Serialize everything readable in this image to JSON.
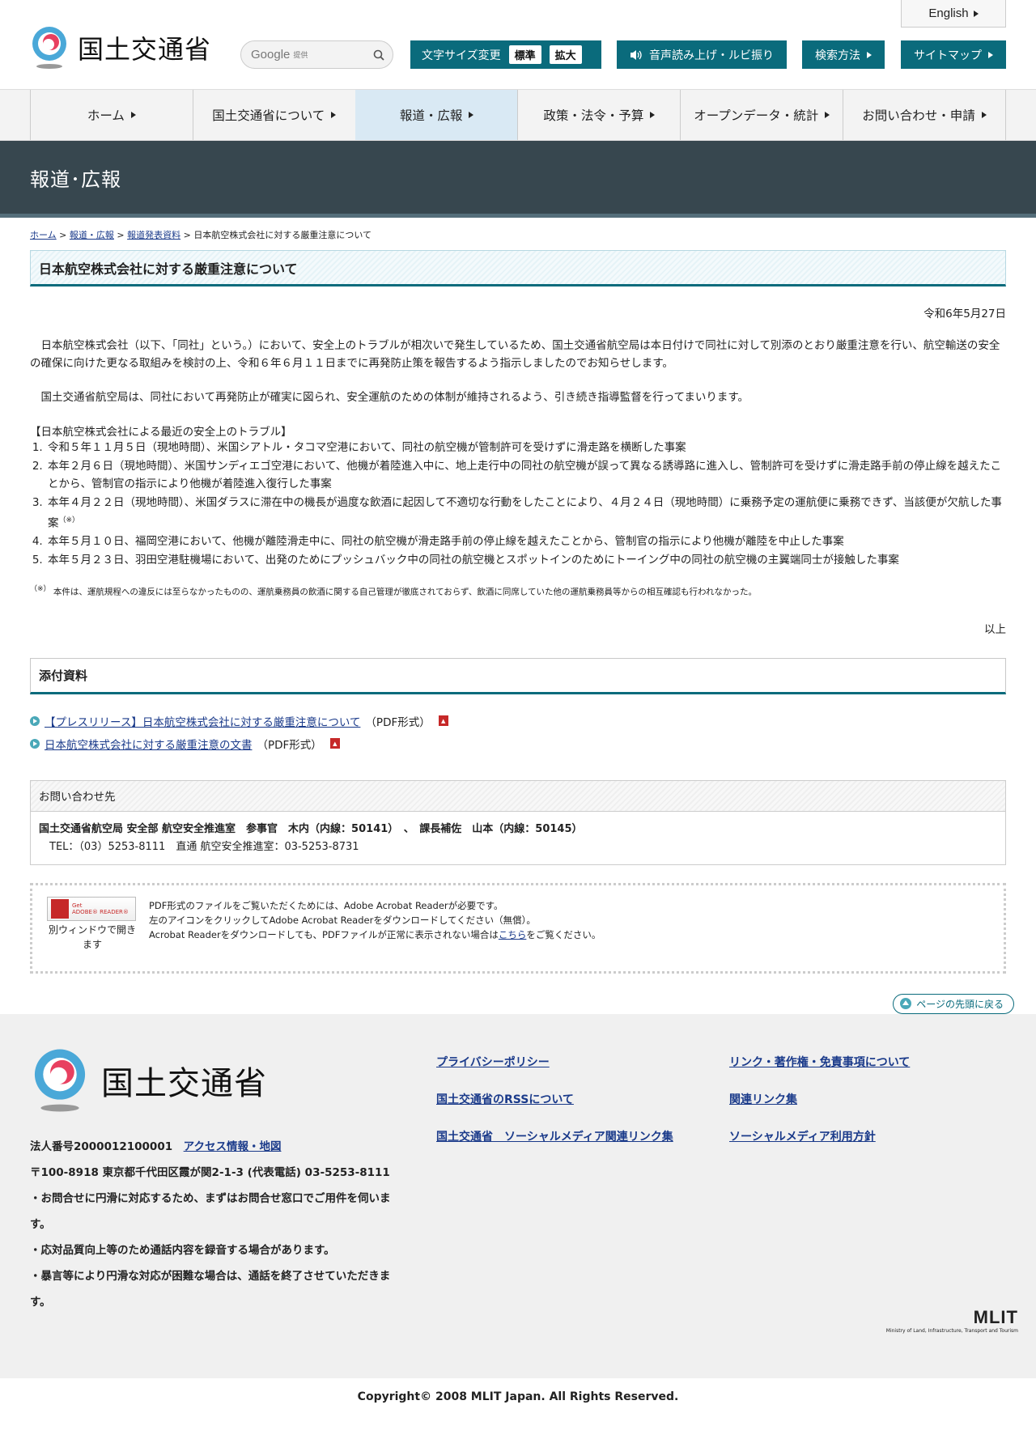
{
  "header": {
    "english": "English",
    "logo_text": "国土交通省",
    "search": {
      "label": "Google",
      "sub": "提供"
    },
    "font_size": {
      "label": "文字サイズ変更",
      "standard": "標準",
      "large": "拡大"
    },
    "voice": "音声読み上げ・ルビ振り",
    "search_method": "検索方法",
    "sitemap": "サイトマップ"
  },
  "nav": [
    "ホーム",
    "国土交通省について",
    "報道・広報",
    "政策・法令・予算",
    "オープンデータ・統計",
    "お問い合わせ・申請"
  ],
  "banner": "報道･広報",
  "breadcrumb": [
    "ホーム",
    "報道・広報",
    "報道発表資料",
    "日本航空株式会社に対する厳重注意について"
  ],
  "title": "日本航空株式会社に対する厳重注意について",
  "date": "令和6年5月27日",
  "para1": "日本航空株式会社（以下、「同社」という。）において、安全上のトラブルが相次いで発生しているため、国土交通省航空局は本日付けで同社に対して別添のとおり厳重注意を行い、航空輸送の安全の確保に向けた更なる取組みを検討の上、令和６年６月１１日までに再発防止策を報告するよう指示しましたのでお知らせします。",
  "para2": "国土交通省航空局は、同社において再発防止が確実に図られ、安全運航のための体制が維持されるよう、引き続き指導監督を行ってまいります。",
  "list_heading": "【日本航空株式会社による最近の安全上のトラブル】",
  "incidents": [
    "令和５年１１月５日（現地時間）、米国シアトル・タコマ空港において、同社の航空機が管制許可を受けずに滑走路を横断した事案",
    "本年２月６日（現地時間）、米国サンディエゴ空港において、他機が着陸進入中に、地上走行中の同社の航空機が誤って異なる誘導路に進入し、管制許可を受けずに滑走路手前の停止線を越えたことから、管制官の指示により他機が着陸進入復行した事案",
    "本年４月２２日（現地時間）、米国ダラスに滞在中の機長が過度な飲酒に起因して不適切な行動をしたことにより、４月２４日（現地時間）に乗務予定の運航便に乗務できず、当該便が欠航した事案",
    "本年５月１０日、福岡空港において、他機が離陸滑走中に、同社の航空機が滑走路手前の停止線を越えたことから、管制官の指示により他機が離陸を中止した事案",
    "本年５月２３日、羽田空港駐機場において、出発のためにプッシュバック中の同社の航空機とスポットインのためにトーイング中の同社の航空機の主翼端同士が接触した事案"
  ],
  "incident3_sup": "（※）",
  "note_mark": "（※）",
  "note": "本件は、運航規程への違反には至らなかったものの、運航乗務員の飲酒に関する自己管理が徹底されておらず、飲酒に同席していた他の運航乗務員等からの相互確認も行われなかった。",
  "ijo": "以上",
  "attachments": {
    "heading": "添付資料",
    "items": [
      {
        "label": "【プレスリリース】日本航空株式会社に対する厳重注意について",
        "format": "（PDF形式）"
      },
      {
        "label": "日本航空株式会社に対する厳重注意の文書",
        "format": "（PDF形式）"
      }
    ]
  },
  "contact": {
    "heading": "お問い合わせ先",
    "line1": "国土交通省航空局 安全部 航空安全推進室　参事官　木内（内線：50141）　、　課長補佐　山本（内線：50145）",
    "line2": "TEL：（03）5253-8111　直通 航空安全推進室：03-5253-8731"
  },
  "adobe": {
    "badge_get": "Get",
    "badge_name": "ADOBE® READER®",
    "caption": "別ウィンドウで開きます",
    "text1": "PDF形式のファイルをご覧いただくためには、Adobe Acrobat Readerが必要です。",
    "text2": "左のアイコンをクリックしてAdobe Acrobat Readerをダウンロードしてください（無償）。",
    "text3a": "Acrobat Readerをダウンロードしても、PDFファイルが正常に表示されない場合は",
    "text3link": "こちら",
    "text3b": "をご覧ください。"
  },
  "page_top": "ページの先頭に戻る",
  "footer": {
    "logo_text": "国土交通省",
    "corp_no": "法人番号2000012100001",
    "access": "アクセス情報・地図",
    "address": "〒100-8918 東京都千代田区霞が関2-1-3 (代表電話) 03-5253-8111",
    "notice1": "・お問合せに円滑に対応するため、まずはお問合せ窓口でご用件を伺います。",
    "notice2": "・応対品質向上等のため通話内容を録音する場合があります。",
    "notice3": "・暴言等により円滑な対応が困難な場合は、通話を終了させていただきます。",
    "links": [
      "プライバシーポリシー",
      "リンク・著作権・免責事項について",
      "国土交通省のRSSについて",
      "関連リンク集",
      "国土交通省　ソーシャルメディア関連リンク集",
      "ソーシャルメディア利用方針"
    ],
    "mlit": "MLIT",
    "mlit_sub": "Ministry of Land, Infrastructure, Transport and Tourism",
    "copyright": "Copyright© 2008 MLIT Japan. All Rights Reserved."
  },
  "colors": {
    "teal": "#0a6b7c",
    "banner": "#37474f",
    "nav_active": "#d9e9f4",
    "link": "#1a3a8a"
  }
}
